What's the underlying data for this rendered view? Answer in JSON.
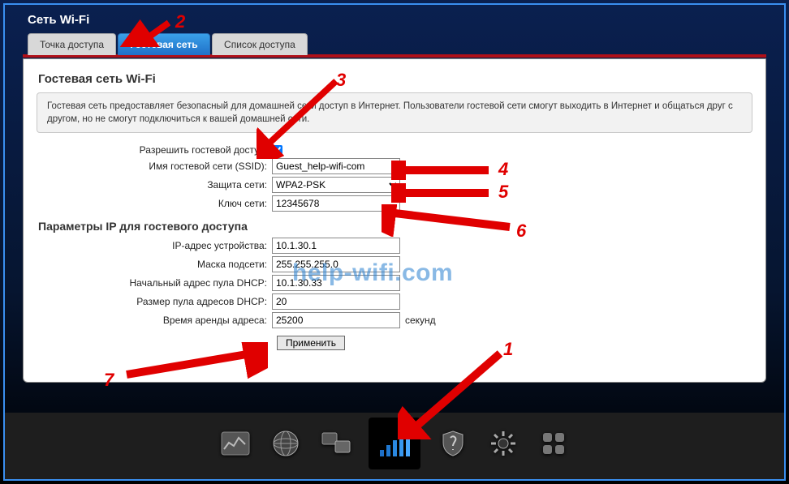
{
  "header": {
    "title": "Сеть Wi-Fi"
  },
  "tabs": {
    "ap": "Точка доступа",
    "guest": "Гостевая сеть",
    "acl": "Список доступа"
  },
  "panel": {
    "title": "Гостевая сеть Wi-Fi",
    "info": "Гостевая сеть предоставляет безопасный для домашней сети доступ в Интернет. Пользователи гостевой сети смогут выходить в Интернет и общаться друг с другом, но не смогут подключиться к вашей домашней сети."
  },
  "form": {
    "enable_label": "Разрешить гостевой доступ:",
    "ssid_label": "Имя гостевой сети (SSID):",
    "ssid_value": "Guest_help-wifi-com",
    "security_label": "Защита сети:",
    "security_value": "WPA2-PSK",
    "key_label": "Ключ сети:",
    "key_value": "12345678",
    "ip_section": "Параметры IP для гостевого доступа",
    "dev_ip_label": "IP-адрес устройства:",
    "dev_ip_value": "10.1.30.1",
    "mask_label": "Маска подсети:",
    "mask_value": "255.255.255.0",
    "pool_start_label": "Начальный адрес пула DHCP:",
    "pool_start_value": "10.1.30.33",
    "pool_size_label": "Размер пула адресов DHCP:",
    "pool_size_value": "20",
    "lease_label": "Время аренды адреса:",
    "lease_value": "25200",
    "lease_unit": "секунд",
    "apply": "Применить"
  },
  "toolbar_icons": {
    "status": "status-graph-icon",
    "internet": "globe-icon",
    "lan": "lan-icon",
    "wifi": "wifi-bars-icon",
    "firewall": "shield-icon",
    "settings": "gear-icon",
    "apps": "apps-icon"
  },
  "annotations": {
    "n1": "1",
    "n2": "2",
    "n3": "3",
    "n4": "4",
    "n5": "5",
    "n6": "6",
    "n7": "7"
  },
  "watermark": "help-wifi.com"
}
